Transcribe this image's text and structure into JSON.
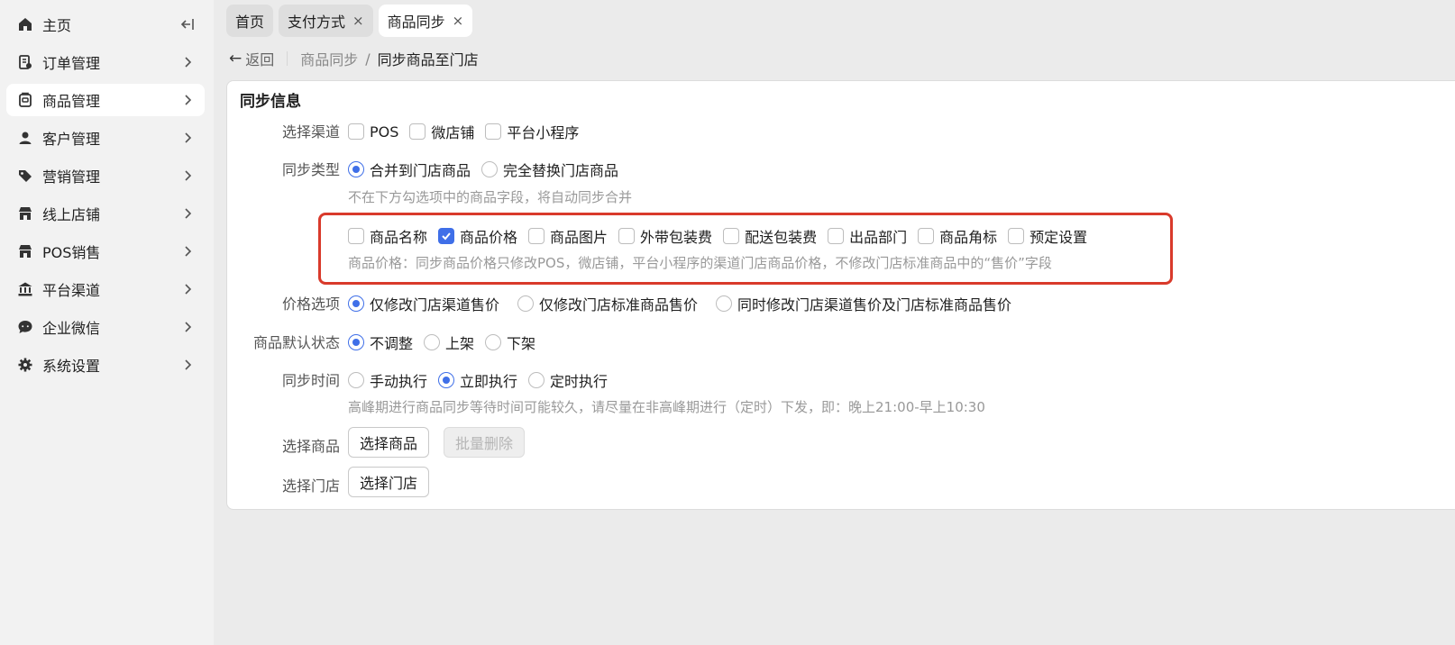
{
  "sidebar": {
    "items": [
      {
        "label": "主页",
        "icon": "home-icon"
      },
      {
        "label": "订单管理",
        "icon": "order-icon"
      },
      {
        "label": "商品管理",
        "icon": "goods-icon"
      },
      {
        "label": "客户管理",
        "icon": "user-icon"
      },
      {
        "label": "营销管理",
        "icon": "tag-icon"
      },
      {
        "label": "线上店铺",
        "icon": "store-icon"
      },
      {
        "label": "POS销售",
        "icon": "pos-store-icon"
      },
      {
        "label": "平台渠道",
        "icon": "bank-icon"
      },
      {
        "label": "企业微信",
        "icon": "chat-icon"
      },
      {
        "label": "系统设置",
        "icon": "gear-icon"
      }
    ],
    "active_index": 2
  },
  "tabs": [
    {
      "label": "首页",
      "closable": false
    },
    {
      "label": "支付方式",
      "closable": true
    },
    {
      "label": "商品同步",
      "closable": true,
      "active": true
    }
  ],
  "tab_close_glyph": "×",
  "breadcrumb": {
    "back_label": "返回",
    "parent": "商品同步",
    "separator": "/",
    "current": "同步商品至门店"
  },
  "form": {
    "section_title": "同步信息",
    "channel": {
      "label": "选择渠道",
      "options": [
        {
          "label": "POS",
          "checked": false
        },
        {
          "label": "微店铺",
          "checked": false
        },
        {
          "label": "平台小程序",
          "checked": false
        }
      ]
    },
    "sync_type": {
      "label": "同步类型",
      "options": [
        {
          "label": "合并到门店商品",
          "checked": true
        },
        {
          "label": "完全替换门店商品",
          "checked": false
        }
      ],
      "hint": "不在下方勾选项中的商品字段，将自动同步合并"
    },
    "fields": {
      "options": [
        {
          "label": "商品名称",
          "checked": false
        },
        {
          "label": "商品价格",
          "checked": true
        },
        {
          "label": "商品图片",
          "checked": false
        },
        {
          "label": "外带包装费",
          "checked": false
        },
        {
          "label": "配送包装费",
          "checked": false
        },
        {
          "label": "出品部门",
          "checked": false
        },
        {
          "label": "商品角标",
          "checked": false
        },
        {
          "label": "预定设置",
          "checked": false
        }
      ],
      "hint": "商品价格：同步商品价格只修改POS，微店铺，平台小程序的渠道门店商品价格，不修改门店标准商品中的“售价”字段"
    },
    "price_option": {
      "label": "价格选项",
      "options": [
        {
          "label": "仅修改门店渠道售价",
          "checked": true
        },
        {
          "label": "仅修改门店标准商品售价",
          "checked": false
        },
        {
          "label": "同时修改门店渠道售价及门店标准商品售价",
          "checked": false
        }
      ]
    },
    "default_status": {
      "label": "商品默认状态",
      "options": [
        {
          "label": "不调整",
          "checked": true
        },
        {
          "label": "上架",
          "checked": false
        },
        {
          "label": "下架",
          "checked": false
        }
      ]
    },
    "sync_time": {
      "label": "同步时间",
      "options": [
        {
          "label": "手动执行",
          "checked": false
        },
        {
          "label": "立即执行",
          "checked": true
        },
        {
          "label": "定时执行",
          "checked": false
        }
      ],
      "hint": "高峰期进行商品同步等待时间可能较久，请尽量在非高峰期进行（定时）下发，即：晚上21:00-早上10:30"
    },
    "select_goods": {
      "label": "选择商品",
      "button": "选择商品",
      "batch_delete": "批量删除"
    },
    "select_store": {
      "label": "选择门店",
      "button": "选择门店"
    }
  },
  "colors": {
    "accent": "#3f6fe8",
    "highlight_border": "#d93a2b"
  }
}
